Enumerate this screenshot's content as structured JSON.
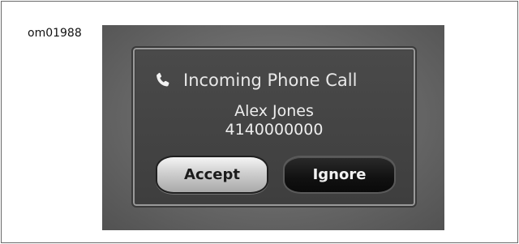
{
  "figure": {
    "id": "om01988"
  },
  "dialog": {
    "title": "Incoming Phone Call",
    "icon": "phone-handset-icon",
    "caller_name": "Alex Jones",
    "caller_number": "4140000000",
    "accept_label": "Accept",
    "ignore_label": "Ignore"
  }
}
